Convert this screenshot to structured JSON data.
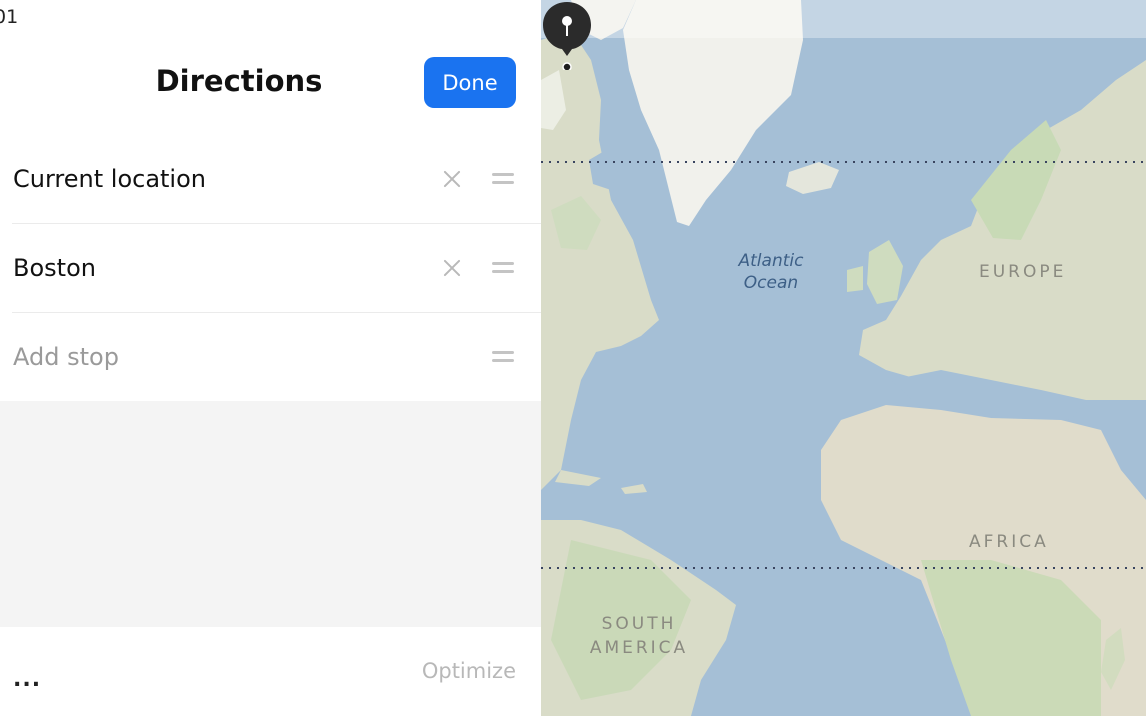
{
  "status_bar": {
    "time": "01"
  },
  "header": {
    "title": "Directions",
    "done_label": "Done"
  },
  "route_points": [
    {
      "label": "Current location",
      "placeholder": false
    },
    {
      "label": "Boston",
      "placeholder": false
    },
    {
      "label": "Add stop",
      "placeholder": true
    }
  ],
  "footer": {
    "more_label": "...",
    "optimize_label": "Optimize"
  },
  "map": {
    "ocean_label": [
      "Atlantic",
      "Ocean"
    ],
    "labels": {
      "europe": "EUROPE",
      "africa": "AFRICA",
      "south_america_line1": "SOUTH",
      "south_america_line2": "AMERICA"
    }
  },
  "colors": {
    "accent": "#1a73f0",
    "water": "#a5bfd6",
    "land": "#d9dcc8",
    "pin": "#2b2b2b"
  }
}
